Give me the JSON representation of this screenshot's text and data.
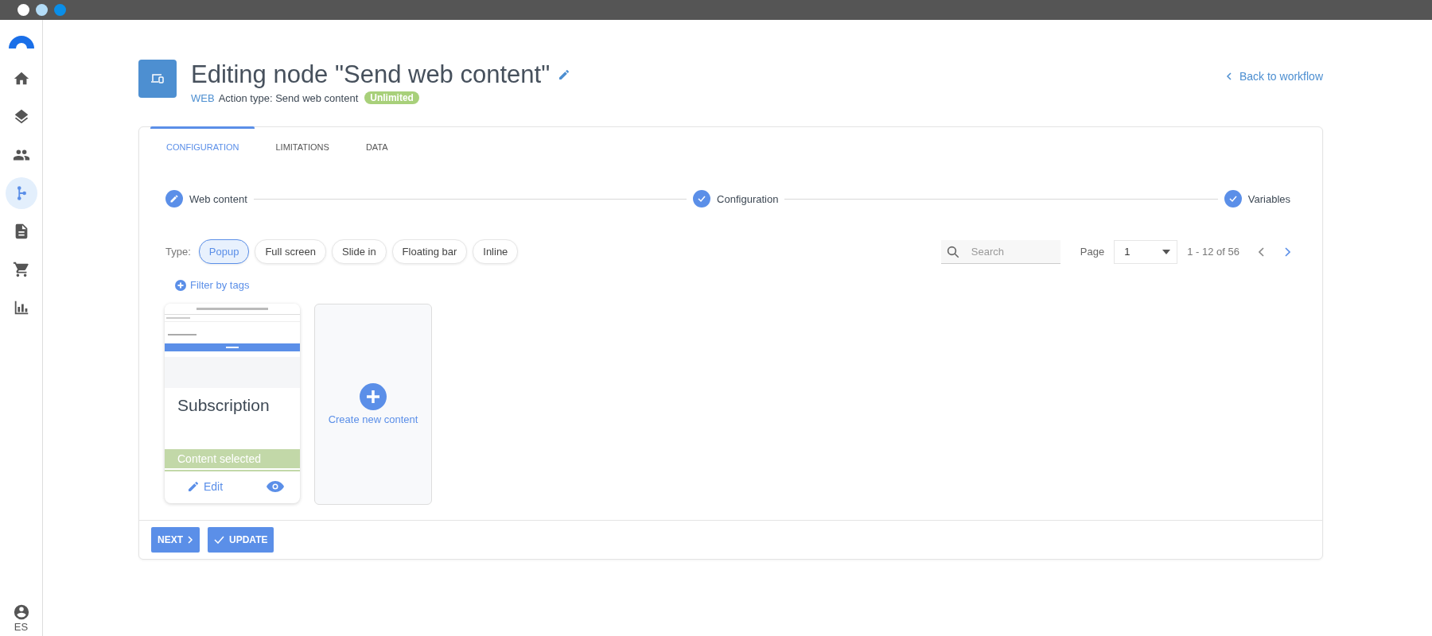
{
  "window": {
    "traffic_lights": [
      {
        "color": "#ffffff"
      },
      {
        "color": "#b3dcf7"
      },
      {
        "color": "#0a8ee8"
      }
    ]
  },
  "sidebar": {
    "items": [
      {
        "kind": "home",
        "selected": false
      },
      {
        "kind": "layers",
        "selected": false
      },
      {
        "kind": "people",
        "selected": false
      },
      {
        "kind": "workflow",
        "selected": true
      },
      {
        "kind": "document",
        "selected": false
      },
      {
        "kind": "cart",
        "selected": false
      },
      {
        "kind": "chart",
        "selected": false
      }
    ],
    "user": "ES"
  },
  "header": {
    "title": "Editing node \"Send web content\"",
    "channel": "WEB",
    "action_type": "Action type: Send web content",
    "limit": "Unlimited",
    "back": "Back to workflow"
  },
  "tabs": [
    {
      "label": "CONFIGURATION",
      "selected": true
    },
    {
      "label": "LIMITATIONS",
      "selected": false
    },
    {
      "label": "DATA",
      "selected": false
    }
  ],
  "steps": [
    {
      "label": "Web content",
      "done": false
    },
    {
      "label": "Configuration",
      "done": true
    },
    {
      "label": "Variables",
      "done": true
    }
  ],
  "type_filter": {
    "label": "Type:",
    "options": [
      {
        "label": "Popup",
        "selected": true
      },
      {
        "label": "Full screen",
        "selected": false
      },
      {
        "label": "Slide in",
        "selected": false
      },
      {
        "label": "Floating bar",
        "selected": false
      },
      {
        "label": "Inline",
        "selected": false
      }
    ]
  },
  "filter_tags": "Filter by tags",
  "search": {
    "placeholder": "Search"
  },
  "pagination": {
    "label": "Page",
    "value": "1",
    "range": "1 - 12 of 56",
    "prev_disabled": true,
    "next_disabled": false
  },
  "contents": [
    {
      "kind": "content",
      "title": "Subscription",
      "selected": true,
      "status": "Content selected",
      "edit": "Edit"
    },
    {
      "kind": "create",
      "label": "Create new content"
    }
  ],
  "buttons": [
    {
      "kind": "next",
      "label": "NEXT"
    },
    {
      "kind": "update",
      "label": "UPDATE"
    }
  ]
}
